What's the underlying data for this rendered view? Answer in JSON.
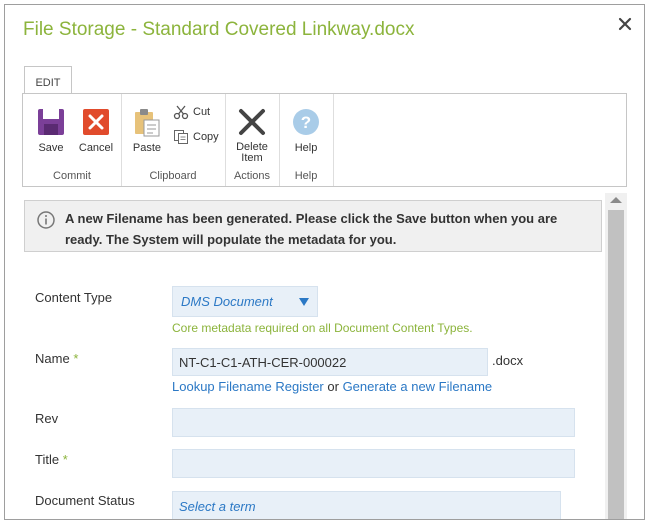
{
  "dialog": {
    "title": "File Storage - Standard Covered Linkway.docx",
    "close_icon": "close-icon"
  },
  "ribbon": {
    "tab": "EDIT",
    "groups": {
      "commit": "Commit",
      "clipboard": "Clipboard",
      "actions": "Actions",
      "help": "Help"
    },
    "buttons": {
      "save": "Save",
      "cancel": "Cancel",
      "paste": "Paste",
      "cut": "Cut",
      "copy": "Copy",
      "delete_line1": "Delete",
      "delete_line2": "Item",
      "help": "Help"
    }
  },
  "notice": {
    "text": "A new Filename has been generated. Please click the Save button when you are ready. The System will populate the metadata for you."
  },
  "form": {
    "content_type": {
      "label": "Content Type",
      "value": "DMS Document",
      "hint": "Core metadata required on all Document Content Types."
    },
    "name": {
      "label": "Name",
      "required": "*",
      "value": "NT-C1-C1-ATH-CER-000022",
      "extension": ".docx",
      "lookup_link": "Lookup Filename Register",
      "or": "or",
      "generate_link": "Generate a new Filename"
    },
    "rev": {
      "label": "Rev",
      "value": ""
    },
    "title": {
      "label": "Title",
      "required": "*",
      "value": ""
    },
    "document_status": {
      "label": "Document Status",
      "placeholder": "Select a term"
    }
  },
  "colors": {
    "accent_green": "#8cb43c",
    "link_blue": "#2b78c5",
    "field_bg": "#e8f0f8"
  }
}
